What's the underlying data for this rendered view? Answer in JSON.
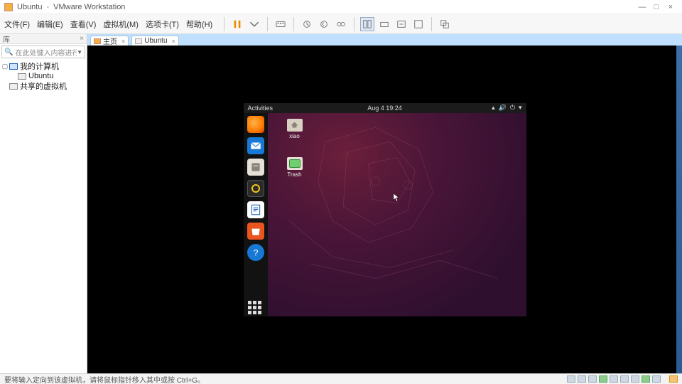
{
  "window": {
    "vm_name": "Ubuntu",
    "app_name": "VMware Workstation",
    "min_glyph": "—",
    "max_glyph": "□",
    "close_glyph": "×"
  },
  "menu": {
    "items": [
      "文件(F)",
      "编辑(E)",
      "查看(V)",
      "虚拟机(M)",
      "选项卡(T)",
      "帮助(H)"
    ]
  },
  "sidebar": {
    "header": "库",
    "search_placeholder": "在此处键入内容进行搜…",
    "nodes": {
      "root": "我的计算机",
      "vm": "Ubuntu",
      "shared": "共享的虚拟机"
    }
  },
  "tabs": {
    "home": "主页",
    "vm": "Ubuntu"
  },
  "ubuntu": {
    "activities": "Activities",
    "clock": "Aug 4  19:24",
    "desk": {
      "home_label": "xiao",
      "trash_label": "Trash"
    }
  },
  "statusbar": {
    "hint": "要将输入定向到该虚拟机，请将鼠标指针移入其中或按 Ctrl+G。"
  }
}
